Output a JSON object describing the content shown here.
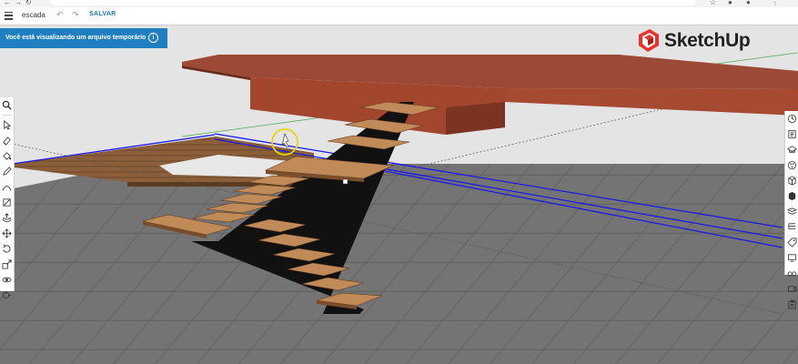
{
  "app": {
    "file_name": "escada",
    "save_label": "SALVAR",
    "undo_glyph": "↶",
    "redo_glyph": "↷"
  },
  "banner": {
    "text": "Você está visualizando um arquivo temporário",
    "info_glyph": "i"
  },
  "logo": {
    "text": "SketchUp"
  },
  "left_toolbar": [
    {
      "name": "search-icon"
    },
    {
      "name": "select-arrow-icon"
    },
    {
      "name": "eraser-icon"
    },
    {
      "name": "paint-bucket-icon"
    },
    {
      "name": "pencil-icon"
    },
    {
      "name": "arc-icon"
    },
    {
      "name": "shape-icon"
    },
    {
      "name": "push-pull-icon"
    },
    {
      "name": "move-icon"
    },
    {
      "name": "rotate-icon"
    },
    {
      "name": "scale-icon"
    },
    {
      "name": "orbit-icon"
    },
    {
      "name": "tape-measure-icon"
    },
    {
      "name": "walk-icon"
    }
  ],
  "right_toolbar": [
    {
      "name": "instructor-icon"
    },
    {
      "name": "entity-info-icon"
    },
    {
      "name": "scenes-icon"
    },
    {
      "name": "materials-icon"
    },
    {
      "name": "styles-icon"
    },
    {
      "name": "components-icon"
    },
    {
      "name": "layers-icon"
    },
    {
      "name": "outliner-icon"
    },
    {
      "name": "tag-icon"
    },
    {
      "name": "display-icon"
    },
    {
      "name": "glasses-icon"
    },
    {
      "name": "camera-views-icon"
    },
    {
      "name": "report-icon"
    }
  ],
  "colors": {
    "brand_blue": "#1f7fc0",
    "floor": "#6f6f6f",
    "slab": "#8a3e2c",
    "tread": "#b9875a",
    "stringer": "#111111",
    "selection": "#1a1ae6"
  }
}
